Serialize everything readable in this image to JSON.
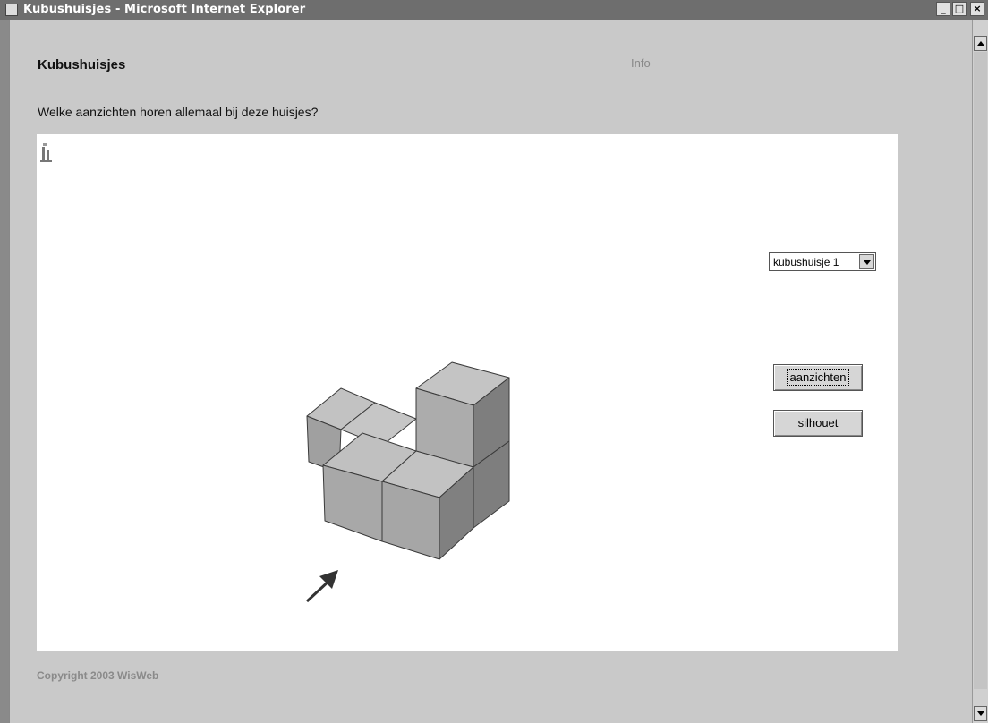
{
  "window": {
    "title": "Kubushuisjes - Microsoft Internet Explorer",
    "controls": [
      "_",
      "□",
      "×"
    ]
  },
  "page": {
    "heading": "Kubushuisjes",
    "info_link": "Info",
    "question": "Welke aanzichten horen allemaal bij deze huisjes?",
    "footer": "Copyright 2003 WisWeb"
  },
  "applet": {
    "house_select": {
      "selected": "kubushuisje 1"
    },
    "buttons": {
      "views": "aanzichten",
      "silhouette": "silhouet"
    },
    "colors": {
      "cube_top": "#c2c2c2",
      "cube_front": "#a8a8a8",
      "cube_side": "#7e7e7e",
      "arrow": "#333333"
    }
  }
}
